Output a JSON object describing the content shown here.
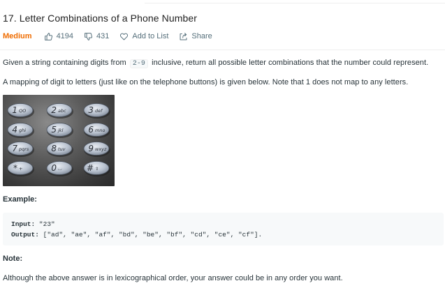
{
  "problem": {
    "title": "17. Letter Combinations of a Phone Number",
    "difficulty": "Medium",
    "likes": "4194",
    "dislikes": "431",
    "add_to_list": "Add to List",
    "share": "Share"
  },
  "description": {
    "p1_before": "Given a string containing digits from",
    "p1_code": "2-9",
    "p1_after": "inclusive, return all possible letter combinations that the number could represent.",
    "p2": "A mapping of digit to letters (just like on the telephone buttons) is given below. Note that 1 does not map to any letters."
  },
  "keypad": {
    "keys": [
      {
        "digit": "1",
        "letters": "QO"
      },
      {
        "digit": "2",
        "letters": "abc"
      },
      {
        "digit": "3",
        "letters": "def"
      },
      {
        "digit": "4",
        "letters": "ghi"
      },
      {
        "digit": "5",
        "letters": "jkl"
      },
      {
        "digit": "6",
        "letters": "mno"
      },
      {
        "digit": "7",
        "letters": "pqrs"
      },
      {
        "digit": "8",
        "letters": "tuv"
      },
      {
        "digit": "9",
        "letters": "wxyz"
      },
      {
        "digit": "*",
        "letters": "+"
      },
      {
        "digit": "0",
        "letters": "⌴"
      },
      {
        "digit": "#",
        "letters": "⇧"
      }
    ]
  },
  "example": {
    "heading": "Example:",
    "input_label": "Input:",
    "input_value": "\"23\"",
    "output_label": "Output:",
    "output_value": "[\"ad\", \"ae\", \"af\", \"bd\", \"be\", \"bf\", \"cd\", \"ce\", \"cf\"]."
  },
  "note": {
    "heading": "Note:",
    "text": "Although the above answer is in lexicographical order, your answer could be in any order you want."
  },
  "colors": {
    "difficulty_medium": "#ef6c00",
    "meta_text": "#546e7a",
    "body_text": "#263238",
    "code_bg": "#f7f9fa"
  }
}
